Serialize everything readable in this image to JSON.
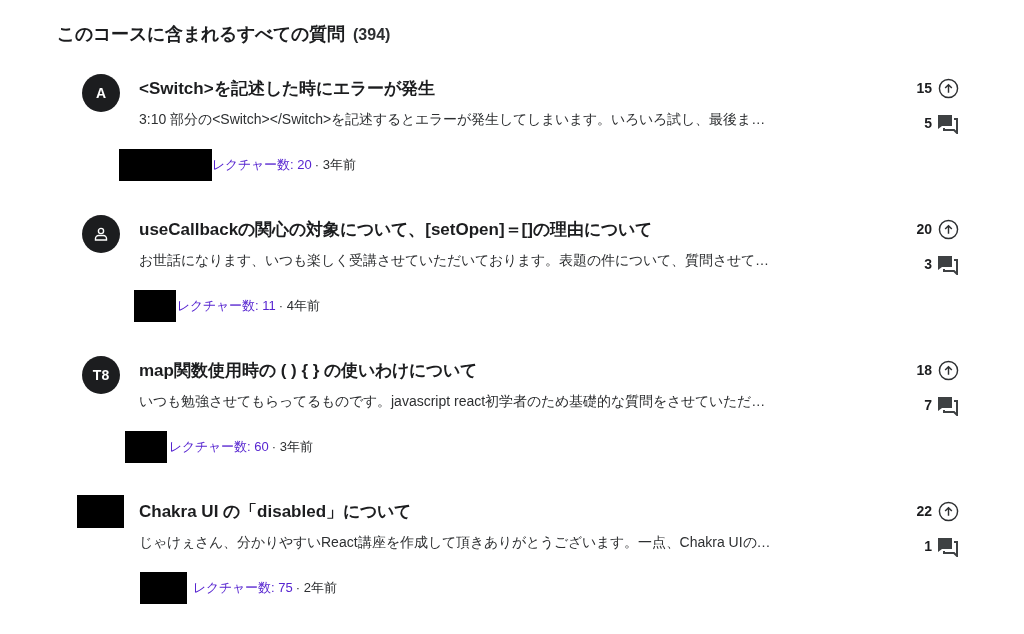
{
  "heading": {
    "title": "このコースに含まれるすべての質問",
    "count": "(394)"
  },
  "questions": [
    {
      "avatar": {
        "kind": "initials",
        "text": "A"
      },
      "title": "<Switch>を記述した時にエラーが発生",
      "excerpt": "3:10 部分の<Switch></Switch>を記述するとエラーが発生してしまいます。いろいろ試し、最後ま…",
      "lecture": "レクチャー数: 20",
      "age": "· 3年前",
      "upvotes": "15",
      "replies": "5"
    },
    {
      "avatar": {
        "kind": "person"
      },
      "title": "useCallbackの関心の対象について、[setOpen]＝[]の理由について",
      "excerpt": "お世話になります、いつも楽しく受講させていただいております。表題の件について、質問させて…",
      "lecture": "レクチャー数: 11",
      "age": "· 4年前",
      "upvotes": "20",
      "replies": "3"
    },
    {
      "avatar": {
        "kind": "initials",
        "text": "T8"
      },
      "title": "map関数使用時の ( ) { } の使いわけについて",
      "excerpt": "いつも勉強させてもらってるものです。javascript react初学者のため基礎的な質問をさせていただ…",
      "lecture": "レクチャー数: 60",
      "age": "· 3年前",
      "upvotes": "18",
      "replies": "7"
    },
    {
      "avatar": {
        "kind": "redacted"
      },
      "title": "Chakra UI の「disabled」について",
      "excerpt": "じゃけぇさん、分かりやすいReact講座を作成して頂きありがとうございます。一点、Chakra UIの…",
      "lecture": "レクチャー数: 75",
      "age": "· 2年前",
      "upvotes": "22",
      "replies": "1"
    }
  ]
}
